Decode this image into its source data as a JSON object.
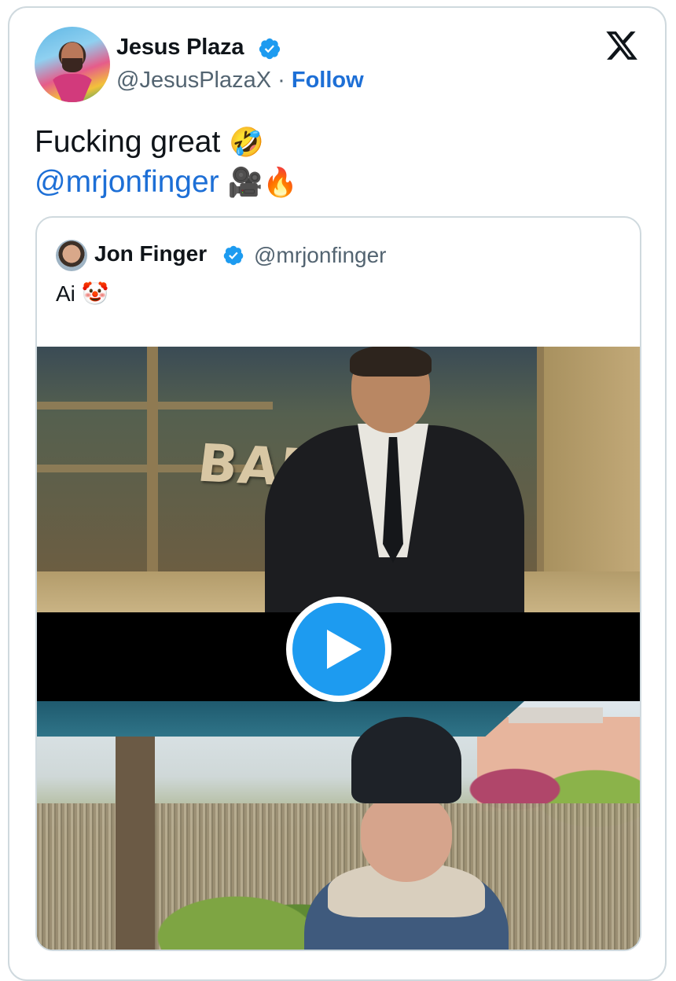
{
  "tweet": {
    "author_name": "Jesus Plaza",
    "author_handle": "@JesusPlazaX",
    "separator": " · ",
    "follow_label": "Follow",
    "text_line1": "Fucking great ",
    "emoji_laugh": "🤣",
    "mention": "@mrjonfinger",
    "emoji_camera": "🎥",
    "emoji_fire": "🔥"
  },
  "quoted": {
    "author_name": "Jon Finger",
    "author_handle": "@mrjonfinger",
    "text": "Ai ",
    "emoji_clown": "🤡"
  },
  "video": {
    "sign_text": "BANK"
  },
  "colors": {
    "accent": "#1d6fd6",
    "play_button": "#1d9bf0",
    "verified": "#1d9bf0",
    "border": "#cfd9de"
  },
  "icons": [
    "verified-badge-icon",
    "x-logo-icon",
    "play-icon"
  ]
}
